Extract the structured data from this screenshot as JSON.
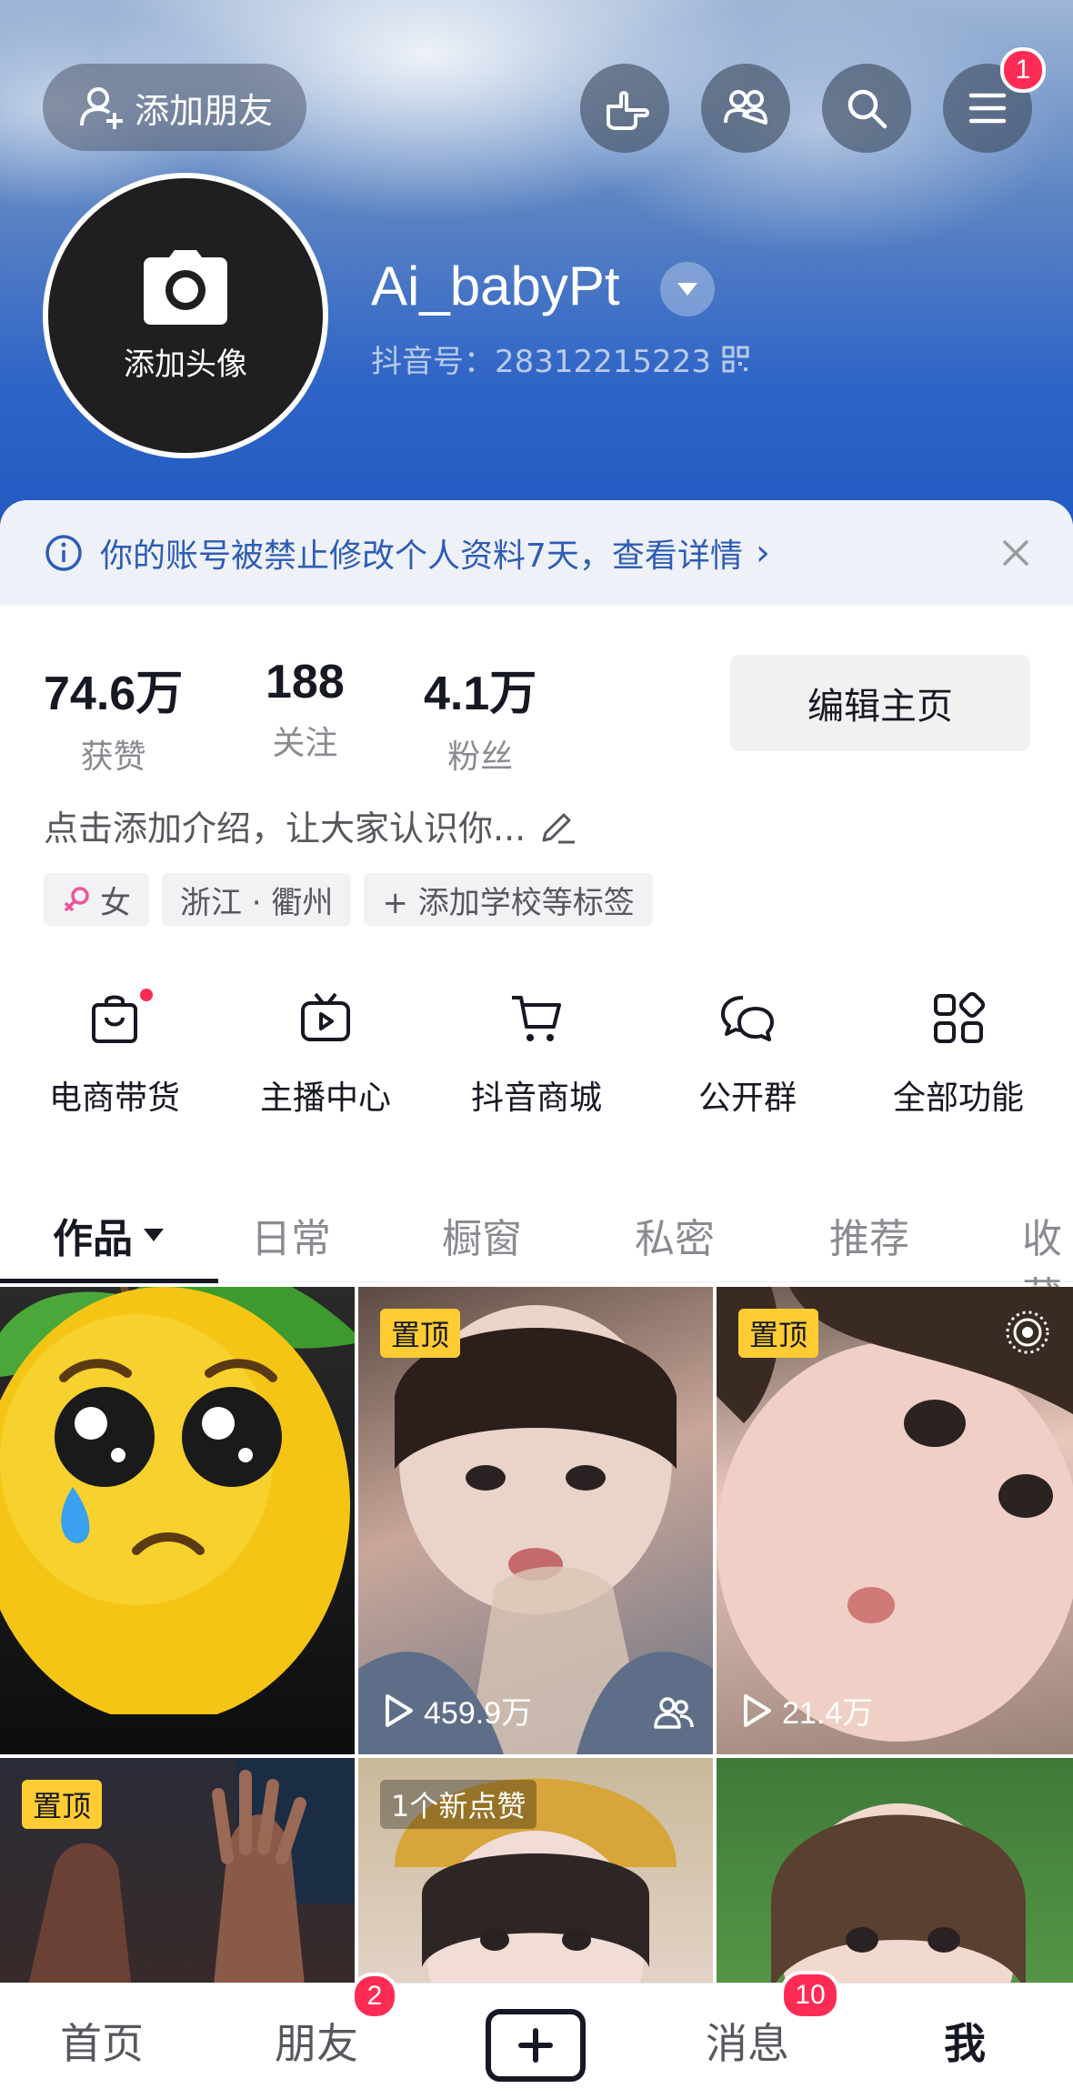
{
  "header": {
    "add_friend_label": "添加朋友",
    "menu_badge": "1",
    "avatar_label": "添加头像",
    "username": "Ai_babyPt",
    "douyin_id": "抖音号：28312215223"
  },
  "notice": {
    "text": "你的账号被禁止修改个人资料7天，查看详情",
    "chevron": "›"
  },
  "stats": [
    {
      "value": "74.6万",
      "label": "获赞"
    },
    {
      "value": "188",
      "label": "关注"
    },
    {
      "value": "4.1万",
      "label": "粉丝"
    }
  ],
  "edit_label": "编辑主页",
  "bio": "点击添加介绍，让大家认识你...",
  "tags": [
    {
      "label": "女"
    },
    {
      "label": "浙江 · 衢州"
    },
    {
      "label": "+ 添加学校等标签"
    }
  ],
  "features": [
    {
      "label": "电商带货",
      "icon": "shopping-bag-icon"
    },
    {
      "label": "主播中心",
      "icon": "tv-play-icon"
    },
    {
      "label": "抖音商城",
      "icon": "cart-icon"
    },
    {
      "label": "公开群",
      "icon": "chat-bubbles-icon"
    },
    {
      "label": "全部功能",
      "icon": "grid-icon"
    }
  ],
  "tabs": [
    {
      "label": "作品",
      "active": true
    },
    {
      "label": "日常"
    },
    {
      "label": "橱窗"
    },
    {
      "label": "私密"
    },
    {
      "label": "推荐"
    },
    {
      "label": "收藏"
    }
  ],
  "videos": [
    {
      "pinned": false,
      "plays": ""
    },
    {
      "pinned": true,
      "pin_label": "置顶",
      "plays": "459.9万"
    },
    {
      "pinned": true,
      "pin_label": "置顶",
      "plays": "21.4万"
    },
    {
      "pinned": true,
      "pin_label": "置顶",
      "plays": ""
    },
    {
      "pinned": false,
      "badge": "1个新点赞",
      "plays": ""
    },
    {
      "pinned": false,
      "plays": ""
    }
  ],
  "bottom_nav": {
    "home": "首页",
    "friends": "朋友",
    "friends_badge": "2",
    "messages": "消息",
    "messages_badge": "10",
    "me": "我"
  },
  "colors": {
    "accent": "#fe2c55",
    "notice_text": "#2f5cb5",
    "pin_bg": "#ffcc33"
  }
}
